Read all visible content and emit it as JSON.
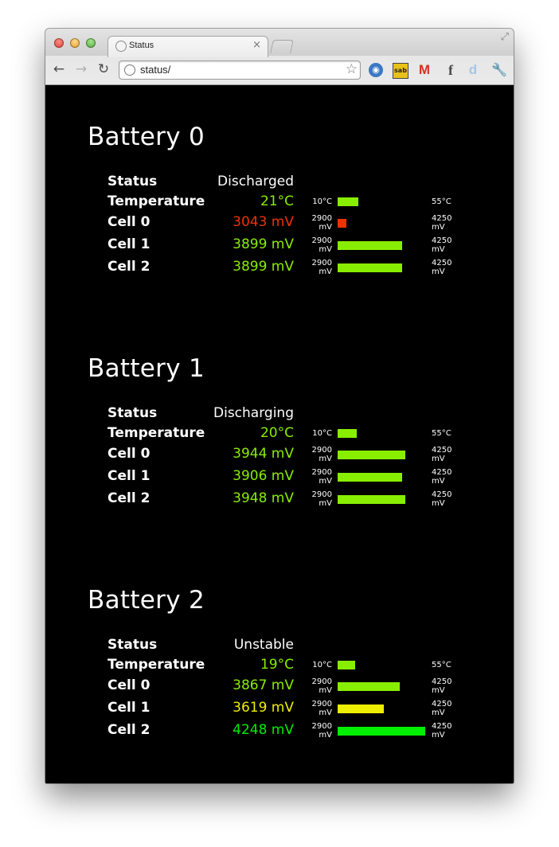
{
  "browser": {
    "tab_title": "Status",
    "tab_close": "×",
    "url": "status/",
    "back_glyph": "←",
    "forward_glyph": "→",
    "reload_glyph": "↻",
    "star_glyph": "☆",
    "restore_glyph": "⤢",
    "extensions": {
      "rss": "◉",
      "sab": "sab",
      "gmail": "M",
      "facebook": "f",
      "delicious": "d",
      "wrench": "🔧"
    }
  },
  "colors": {
    "background": "#000000",
    "ok": "#88ee00",
    "warn": "#eeee00",
    "danger": "#ee3300",
    "full": "#00ee00"
  },
  "batteries": [
    {
      "title": "Battery 0",
      "status_label": "Status",
      "status": "Discharged",
      "temperature_label": "Temperature",
      "temperature": "21°C",
      "temp_min": "10°C",
      "temp_max": "55°C",
      "temp_level": 0.24,
      "cells": [
        {
          "label": "Cell 0",
          "value": "3043 mV",
          "min": "2900 mV",
          "max": "4250 mV",
          "level": 0.1,
          "color": "#ee3300"
        },
        {
          "label": "Cell 1",
          "value": "3899 mV",
          "min": "2900 mV",
          "max": "4250 mV",
          "level": 0.74,
          "color": "#88ee00"
        },
        {
          "label": "Cell 2",
          "value": "3899 mV",
          "min": "2900 mV",
          "max": "4250 mV",
          "level": 0.74,
          "color": "#88ee00"
        }
      ],
      "temp_color": "#88ee00"
    },
    {
      "title": "Battery 1",
      "status_label": "Status",
      "status": "Discharging",
      "temperature_label": "Temperature",
      "temperature": "20°C",
      "temp_min": "10°C",
      "temp_max": "55°C",
      "temp_level": 0.22,
      "cells": [
        {
          "label": "Cell 0",
          "value": "3944 mV",
          "min": "2900 mV",
          "max": "4250 mV",
          "level": 0.77,
          "color": "#88ee00"
        },
        {
          "label": "Cell 1",
          "value": "3906 mV",
          "min": "2900 mV",
          "max": "4250 mV",
          "level": 0.74,
          "color": "#88ee00"
        },
        {
          "label": "Cell 2",
          "value": "3948 mV",
          "min": "2900 mV",
          "max": "4250 mV",
          "level": 0.77,
          "color": "#88ee00"
        }
      ],
      "temp_color": "#88ee00"
    },
    {
      "title": "Battery 2",
      "status_label": "Status",
      "status": "Unstable",
      "temperature_label": "Temperature",
      "temperature": "19°C",
      "temp_min": "10°C",
      "temp_max": "55°C",
      "temp_level": 0.2,
      "cells": [
        {
          "label": "Cell 0",
          "value": "3867 mV",
          "min": "2900 mV",
          "max": "4250 mV",
          "level": 0.71,
          "color": "#88ee00"
        },
        {
          "label": "Cell 1",
          "value": "3619 mV",
          "min": "2900 mV",
          "max": "4250 mV",
          "level": 0.53,
          "color": "#eeee00"
        },
        {
          "label": "Cell 2",
          "value": "4248 mV",
          "min": "2900 mV",
          "max": "4250 mV",
          "level": 1.0,
          "color": "#00ee00"
        }
      ],
      "temp_color": "#88ee00"
    }
  ]
}
